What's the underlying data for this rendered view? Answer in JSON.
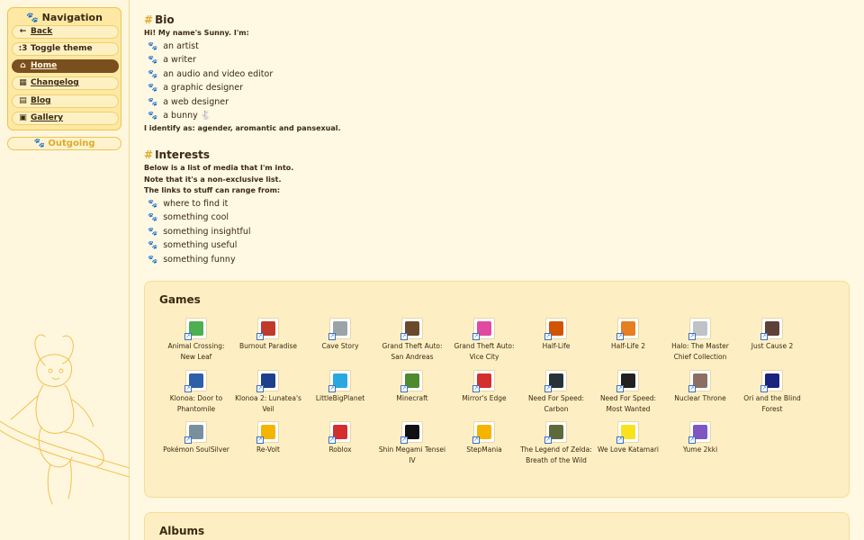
{
  "sidebar": {
    "title": "Navigation",
    "items": [
      {
        "label": "Back",
        "icon": "←"
      },
      {
        "label": "Toggle theme",
        "icon": ":3"
      },
      {
        "label": "Home",
        "icon": "⌂"
      },
      {
        "label": "Changelog",
        "icon": "▦"
      },
      {
        "label": "Blog",
        "icon": "▤"
      },
      {
        "label": "Gallery",
        "icon": "▣"
      }
    ],
    "outgoing": "Outgoing"
  },
  "bio": {
    "heading": "Bio",
    "intro": "Hi! My name's Sunny. I'm:",
    "items": [
      "an artist",
      "a writer",
      "an audio and video editor",
      "a graphic designer",
      "a web designer",
      "a bunny 🐇"
    ],
    "identity": "I identify as: agender, aromantic and pansexual."
  },
  "interests": {
    "heading": "Interests",
    "lines": [
      "Below is a list of media that I'm into.",
      "Note that it's a non-exclusive list.",
      "The links to stuff can range from:"
    ],
    "items": [
      "where to find it",
      "something cool",
      "something insightful",
      "something useful",
      "something funny"
    ]
  },
  "games": {
    "heading": "Games",
    "items": [
      {
        "name": "Animal Crossing: New Leaf",
        "color": "#4caf50"
      },
      {
        "name": "Burnout Paradise",
        "color": "#c0392b"
      },
      {
        "name": "Cave Story",
        "color": "#9aa3a8"
      },
      {
        "name": "Grand Theft Auto: San Andreas",
        "color": "#6b4a2b"
      },
      {
        "name": "Grand Theft Auto: Vice City",
        "color": "#e04aa0"
      },
      {
        "name": "Half-Life",
        "color": "#d35400"
      },
      {
        "name": "Half-Life 2",
        "color": "#e67e22"
      },
      {
        "name": "Halo: The Master Chief Collection",
        "color": "#bdc3c7"
      },
      {
        "name": "Just Cause 2",
        "color": "#5d4037"
      },
      {
        "name": "Klonoa: Door to Phantomile",
        "color": "#2e5fa8"
      },
      {
        "name": "Klonoa 2: Lunatea's Veil",
        "color": "#1e3f8a"
      },
      {
        "name": "LittleBigPlanet",
        "color": "#29a8e0"
      },
      {
        "name": "Minecraft",
        "color": "#4e8a2e"
      },
      {
        "name": "Mirror's Edge",
        "color": "#d32f2f"
      },
      {
        "name": "Need For Speed: Carbon",
        "color": "#263238"
      },
      {
        "name": "Need For Speed: Most Wanted",
        "color": "#212121"
      },
      {
        "name": "Nuclear Throne",
        "color": "#8d6e63"
      },
      {
        "name": "Ori and the Blind Forest",
        "color": "#1a237e"
      },
      {
        "name": "Pokémon SoulSilver",
        "color": "#78909c"
      },
      {
        "name": "Re-Volt",
        "color": "#f4b400"
      },
      {
        "name": "Roblox",
        "color": "#d32f2f"
      },
      {
        "name": "Shin Megami Tensei IV",
        "color": "#111111"
      },
      {
        "name": "StepMania",
        "color": "#f4b400"
      },
      {
        "name": "The Legend of Zelda: Breath of the Wild",
        "color": "#5d6b3a"
      },
      {
        "name": "We Love Katamari",
        "color": "#f9e11e"
      },
      {
        "name": "Yume 2kki",
        "color": "#7e57c2"
      }
    ]
  },
  "albums": {
    "heading": "Albums"
  }
}
